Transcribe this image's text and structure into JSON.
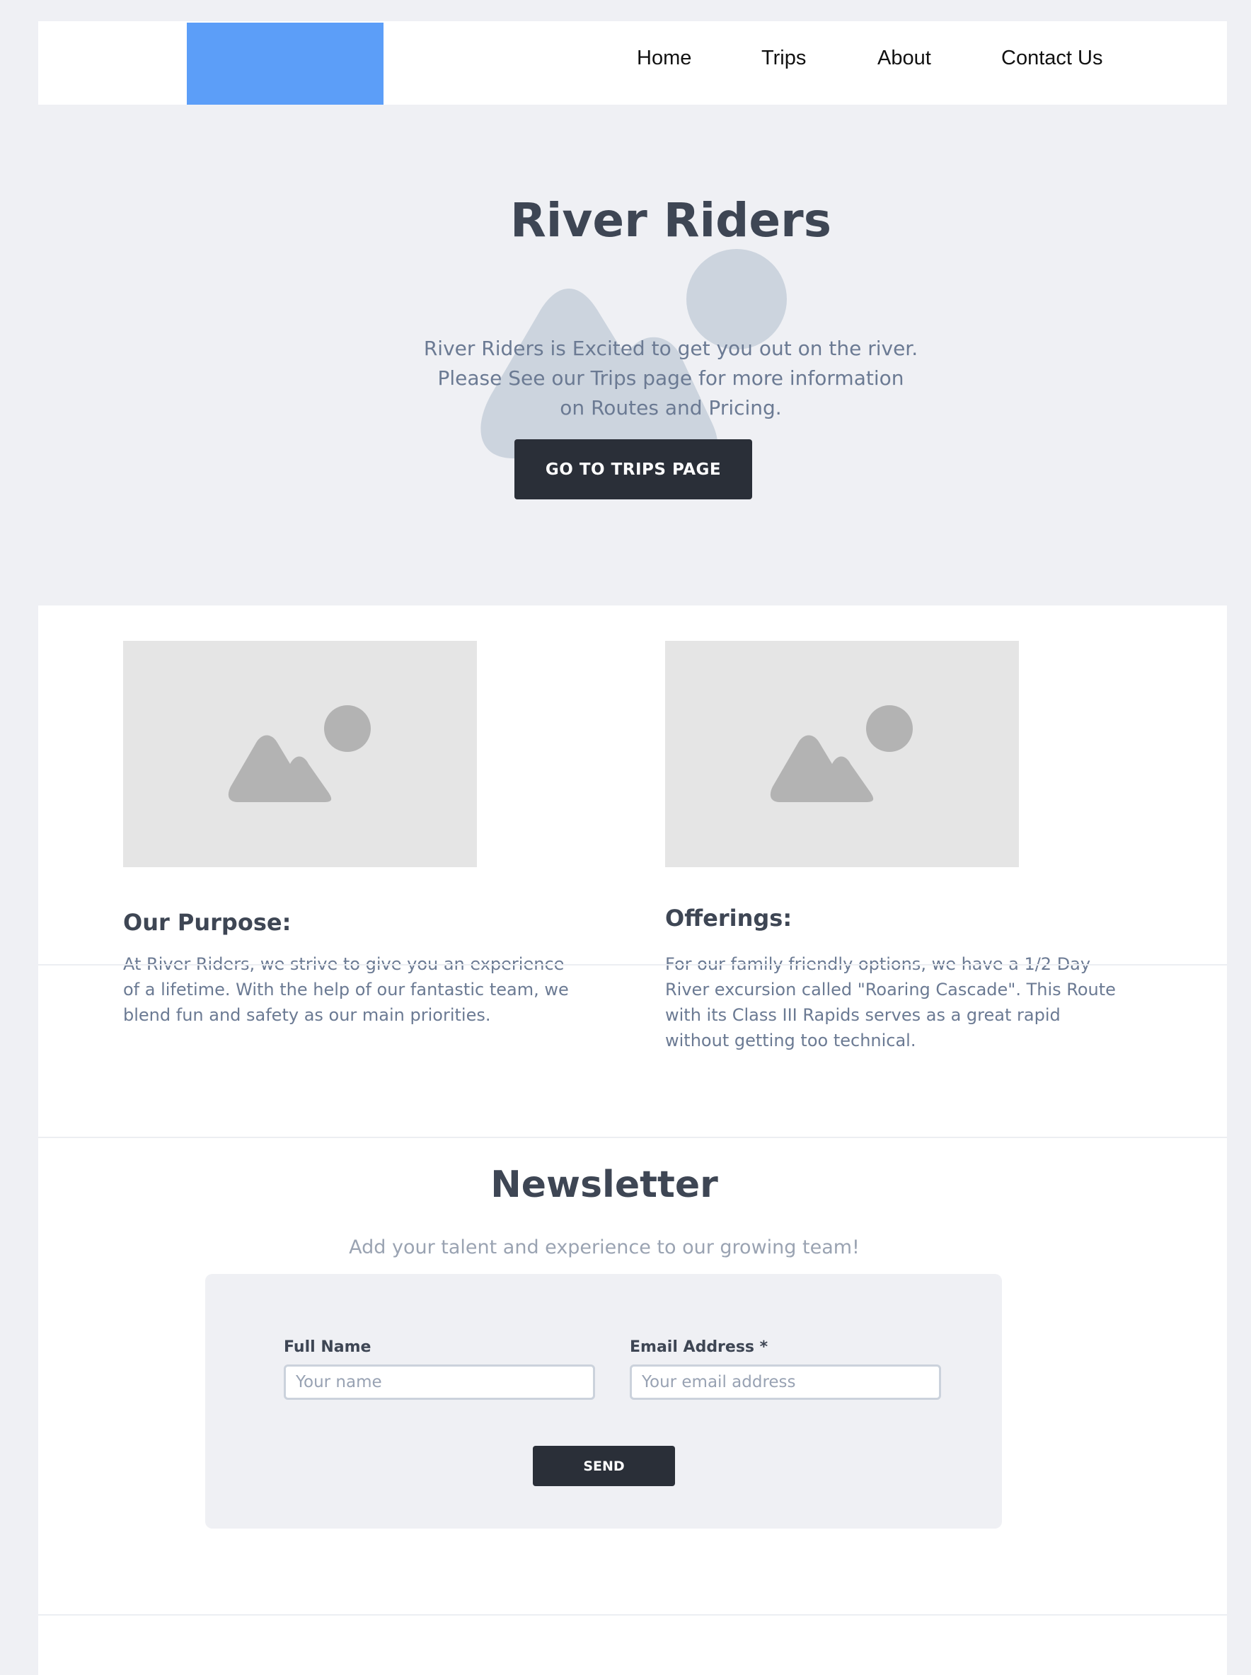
{
  "header": {
    "nav": [
      {
        "label": "Home"
      },
      {
        "label": "Trips"
      },
      {
        "label": "About"
      },
      {
        "label": "Contact Us"
      }
    ]
  },
  "hero": {
    "title": "River Riders",
    "text": "River Riders is Excited to get you out on the river. Please See our Trips page for more information on Routes and Pricing.",
    "button_label": "GO TO TRIPS PAGE",
    "background_icon": "image-placeholder-icon"
  },
  "features": [
    {
      "image_icon": "image-placeholder-icon",
      "title": "Our Purpose:",
      "text": "At River Riders, we strive to give you an experience of a lifetime. With the help of our fantastic team, we blend fun and safety as our main priorities."
    },
    {
      "image_icon": "image-placeholder-icon",
      "title": "Offerings:",
      "text": "For our family friendly options, we have a 1/2 Day River excursion called \"Roaring Cascade\". This Route with its Class III Rapids serves as a great rapid without getting too technical."
    }
  ],
  "newsletter": {
    "title": "Newsletter",
    "subtitle": "Add your talent and experience to our growing team!",
    "full_name_label": "Full Name",
    "full_name_placeholder": "Your name",
    "email_label": "Email Address *",
    "email_placeholder": "Your email address",
    "send_label": "SEND"
  },
  "colors": {
    "logo": "#5c9ef8",
    "button": "#2a2f38",
    "heading": "#3e4654",
    "body_text": "#6b7a93",
    "page_background": "#eff0f4"
  }
}
